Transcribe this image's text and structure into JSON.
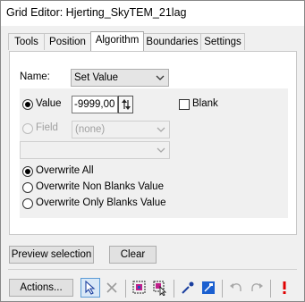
{
  "window": {
    "title": "Grid Editor: Hjerting_SkyTEM_21lag"
  },
  "tabs": [
    {
      "label": "Tools"
    },
    {
      "label": "Position"
    },
    {
      "label": "Algorithm"
    },
    {
      "label": "Boundaries"
    },
    {
      "label": "Settings"
    }
  ],
  "name": {
    "label": "Name:",
    "value": "Set Value"
  },
  "value_option": {
    "label": "Value",
    "input": "-9999,00"
  },
  "blank": {
    "label": "Blank"
  },
  "field_option": {
    "label": "Field",
    "value": "(none)",
    "second_value": ""
  },
  "overwrite": {
    "options": [
      {
        "label": "Overwrite All",
        "selected": true
      },
      {
        "label": "Overwrite Non Blanks Value",
        "selected": false
      },
      {
        "label": "Overwrite Only Blanks Value",
        "selected": false
      }
    ]
  },
  "buttons": {
    "preview": "Preview selection",
    "clear": "Clear",
    "actions": "Actions..."
  },
  "icons": {
    "spin": "spin-updown-icon",
    "select": "pointer-select-icon",
    "cancel": "x-cancel-icon",
    "sel_mask_a": "selection-mask-icon",
    "sel_mask_b": "selection-mask-cursor-icon",
    "pipette": "pipette-icon",
    "fill": "fill-icon",
    "undo": "undo-icon",
    "redo": "redo-icon",
    "alert": "exclamation-icon"
  },
  "colors": {
    "accent": "#0060df",
    "alert": "#e00000",
    "active_border": "#5b9bd5"
  }
}
